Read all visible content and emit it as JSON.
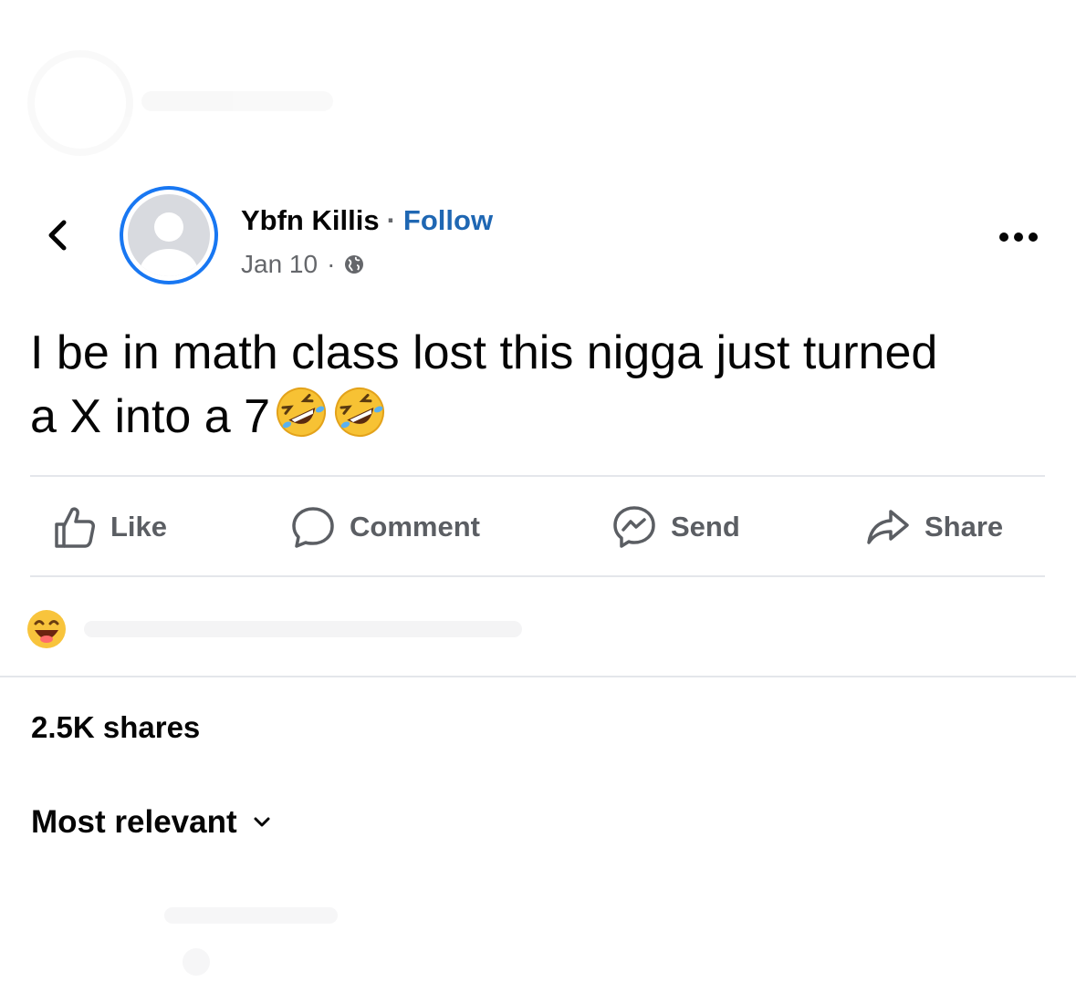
{
  "post": {
    "author_name": "Ybfn Killis",
    "name_separator": "·",
    "follow_label": "Follow",
    "date": "Jan 10",
    "date_separator": "·",
    "audience_icon": "globe-icon",
    "text_line1": "I be in math class lost this nigga just turned",
    "text_line2": "a X into a 7",
    "text_emojis": [
      "rofl-emoji",
      "rofl-emoji"
    ],
    "more_icon": "more-dots-icon"
  },
  "actions": [
    {
      "label": "Like",
      "icon": "thumbs-up-icon"
    },
    {
      "label": "Comment",
      "icon": "comment-bubble-icon"
    },
    {
      "label": "Send",
      "icon": "messenger-icon"
    },
    {
      "label": "Share",
      "icon": "share-arrow-icon"
    }
  ],
  "reactions": {
    "emoji": "haha-emoji"
  },
  "stats": {
    "shares": "2.5K shares"
  },
  "comments": {
    "sort_label": "Most relevant",
    "sort_icon": "chevron-down-icon"
  },
  "colors": {
    "follow": "#1f67b3",
    "avatar_ring": "#1877f2",
    "action_text": "#5b5e63",
    "meta_text": "#65676b",
    "divider": "#e4e6eb"
  }
}
